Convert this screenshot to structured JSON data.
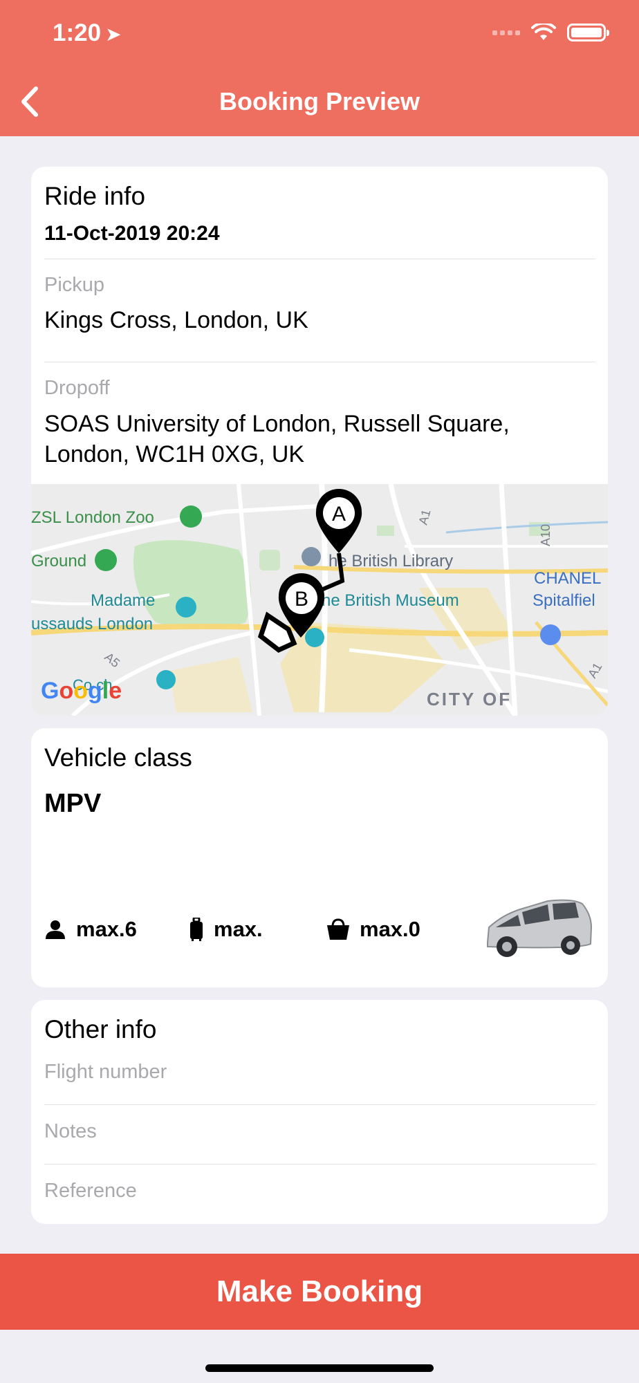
{
  "status_bar": {
    "time": "1:20"
  },
  "header": {
    "title": "Booking Preview"
  },
  "ride_info": {
    "title": "Ride info",
    "datetime": "11-Oct-2019 20:24",
    "pickup_label": "Pickup",
    "pickup_value": "Kings Cross, London, UK",
    "dropoff_label": "Dropoff",
    "dropoff_value": "SOAS University of London, Russell Square, London,  WC1H 0XG, UK"
  },
  "map": {
    "labels": {
      "zoo": "ZSL London Zoo",
      "ground": "Ground",
      "madame1": "Madame",
      "madame2": "ussauds London",
      "library": "he British Library",
      "museum": "he British Museum",
      "chanel": "CHANEL",
      "spitalfields": "Spitalfiel",
      "city": "CITY OF",
      "coalDrops": "Co ch",
      "a1": "A1",
      "a10": "A10",
      "a5": "A5",
      "a1b": "A1"
    },
    "markers": {
      "start": "A",
      "end": "B"
    },
    "logo": "Google",
    "logo_colors": [
      "#4285F4",
      "#EA4335",
      "#FBBC05",
      "#4285F4",
      "#34A853",
      "#EA4335"
    ]
  },
  "vehicle": {
    "title": "Vehicle class",
    "name": "MPV",
    "capacities": {
      "passengers": "max.6",
      "luggage": "max.",
      "bags": "max.0"
    }
  },
  "other_info": {
    "title": "Other info",
    "flight_number_placeholder": "Flight number",
    "notes_placeholder": "Notes",
    "reference_placeholder": "Reference"
  },
  "actions": {
    "make_booking": "Make Booking"
  },
  "colors": {
    "header": "#ee6f60",
    "button": "#eb5545",
    "background": "#efeef4"
  }
}
